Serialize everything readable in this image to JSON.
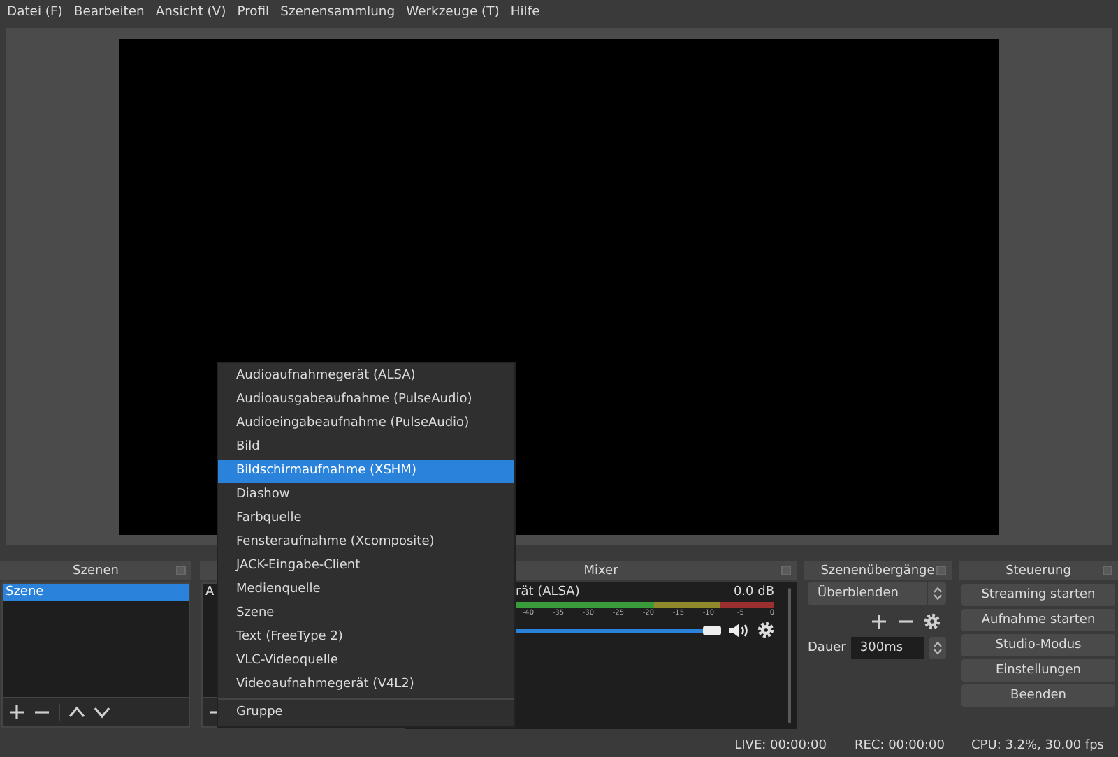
{
  "menu": [
    {
      "label": "Datei (F)"
    },
    {
      "label": "Bearbeiten"
    },
    {
      "label": "Ansicht (V)"
    },
    {
      "label": "Profil"
    },
    {
      "label": "Szenensammlung"
    },
    {
      "label": "Werkzeuge (T)"
    },
    {
      "label": "Hilfe"
    }
  ],
  "scenes": {
    "title": "Szenen",
    "items": [
      {
        "label": "Szene",
        "selected": true
      }
    ]
  },
  "sources": {
    "items": [
      {
        "label": "A"
      }
    ]
  },
  "mixer": {
    "title": "Mixer",
    "channel": {
      "name": "rät (ALSA)",
      "reading": "0.0 dB",
      "ticks": [
        "-40",
        "-35",
        "-30",
        "-25",
        "-20",
        "-15",
        "-10",
        "-5",
        "0"
      ],
      "level": 1,
      "muted": false
    }
  },
  "transitions": {
    "title": "Szenenübergänge",
    "select": "Überblenden",
    "duration_label": "Dauer",
    "duration": "300ms"
  },
  "controls": {
    "title": "Steuerung",
    "buttons": [
      "Streaming starten",
      "Aufnahme starten",
      "Studio-Modus",
      "Einstellungen",
      "Beenden"
    ]
  },
  "popup": {
    "items": [
      {
        "label": "Audioaufnahmegerät (ALSA)",
        "selected": false
      },
      {
        "label": "Audioausgabeaufnahme (PulseAudio)",
        "selected": false
      },
      {
        "label": "Audioeingabeaufnahme (PulseAudio)",
        "selected": false
      },
      {
        "label": "Bild",
        "selected": false
      },
      {
        "label": "Bildschirmaufnahme (XSHM)",
        "selected": true
      },
      {
        "label": "Diashow",
        "selected": false
      },
      {
        "label": "Farbquelle",
        "selected": false
      },
      {
        "label": "Fensteraufnahme (Xcomposite)",
        "selected": false
      },
      {
        "label": "JACK-Eingabe-Client",
        "selected": false
      },
      {
        "label": "Medienquelle",
        "selected": false
      },
      {
        "label": "Szene",
        "selected": false
      },
      {
        "label": "Text (FreeType 2)",
        "selected": false
      },
      {
        "label": "VLC-Videoquelle",
        "selected": false
      },
      {
        "label": "Videoaufnahmegerät (V4L2)",
        "selected": false
      }
    ],
    "footer": "Gruppe"
  },
  "status": {
    "live": "LIVE: 00:00:00",
    "rec": "REC: 00:00:00",
    "cpu": "CPU: 3.2%, 30.00 fps"
  }
}
